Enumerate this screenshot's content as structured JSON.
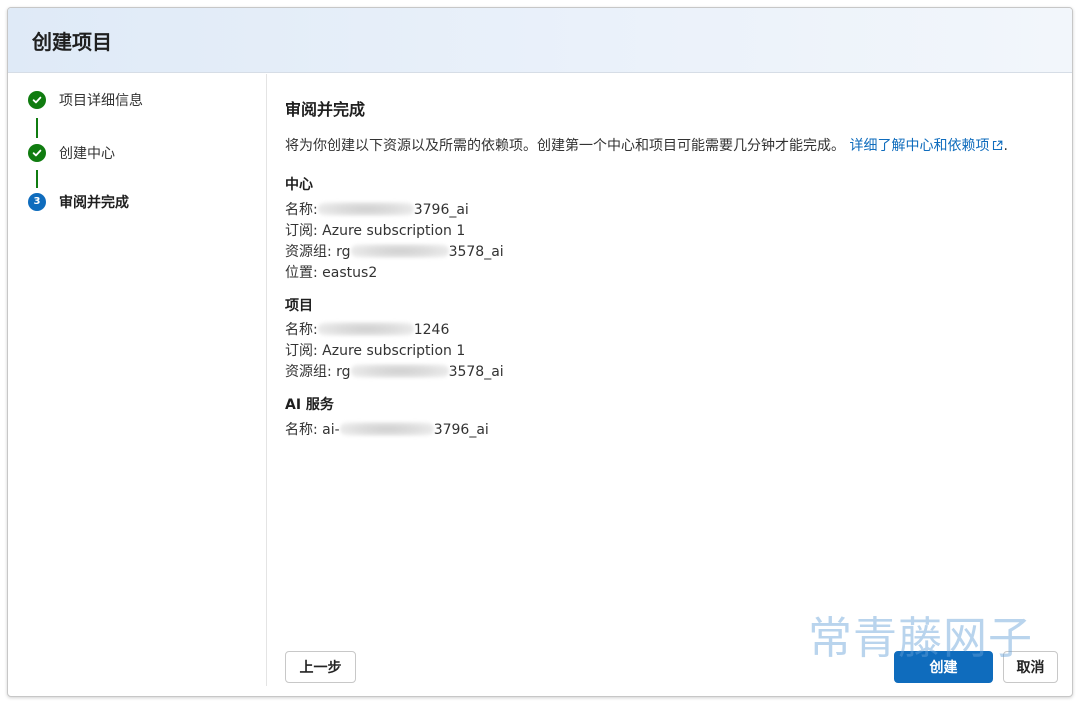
{
  "dialog": {
    "title": "创建项目"
  },
  "steps": [
    {
      "label": "项目详细信息",
      "state": "done"
    },
    {
      "label": "创建中心",
      "state": "done"
    },
    {
      "label": "审阅并完成",
      "state": "active",
      "number": "3"
    }
  ],
  "review": {
    "title": "审阅并完成",
    "intro": "将为你创建以下资源以及所需的依赖项。创建第一个中心和项目可能需要几分钟才能完成。",
    "link_text": "详细了解中心和依赖项",
    "link_suffix": ".",
    "hub": {
      "title": "中心",
      "name_label": "名称:",
      "name_value": "3796_ai",
      "subscription_label": "订阅:",
      "subscription_value": "Azure subscription 1",
      "resource_group_label": "资源组:",
      "resource_group_prefix": "rg",
      "resource_group_value": "3578_ai",
      "location_label": "位置:",
      "location_value": "eastus2"
    },
    "project": {
      "title": "项目",
      "name_label": "名称:",
      "name_value": "1246",
      "subscription_label": "订阅:",
      "subscription_value": "Azure subscription 1",
      "resource_group_label": "资源组:",
      "resource_group_prefix": "rg",
      "resource_group_value": "3578_ai"
    },
    "ai_service": {
      "title": "AI 服务",
      "name_label": "名称:",
      "name_prefix": "ai-",
      "name_value": "3796_ai"
    }
  },
  "buttons": {
    "back": "上一步",
    "create": "创建",
    "cancel": "取消"
  },
  "watermark": "常青藤网子",
  "colors": {
    "accent": "#0f6cbd",
    "success": "#107c10",
    "header_bg": "#e6eef8"
  },
  "icons": {
    "done": "checkmark-circle-icon",
    "active": "step-number-icon",
    "link": "open-external-icon"
  }
}
